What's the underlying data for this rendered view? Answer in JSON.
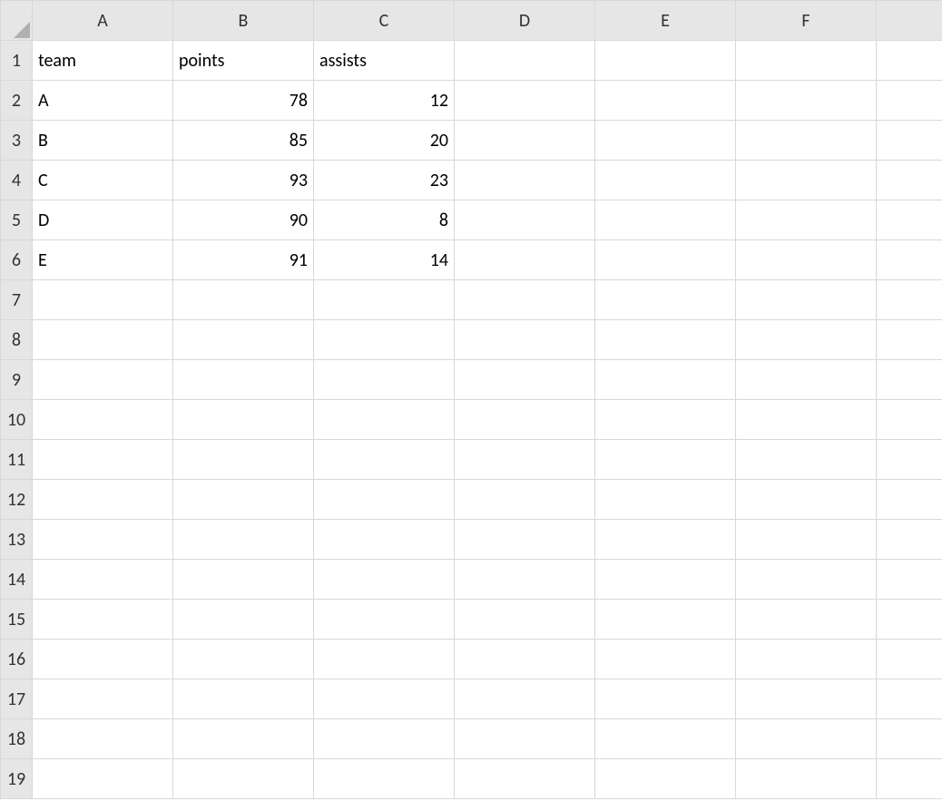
{
  "columns": [
    "A",
    "B",
    "C",
    "D",
    "E",
    "F",
    ""
  ],
  "rows": [
    "1",
    "2",
    "3",
    "4",
    "5",
    "6",
    "7",
    "8",
    "9",
    "10",
    "11",
    "12",
    "13",
    "14",
    "15",
    "16",
    "17",
    "18",
    "19"
  ],
  "cells": {
    "A1": "team",
    "B1": "points",
    "C1": "assists",
    "A2": "A",
    "B2": "78",
    "C2": "12",
    "A3": "B",
    "B3": "85",
    "C3": "20",
    "A4": "C",
    "B4": "93",
    "C4": "23",
    "A5": "D",
    "B5": "90",
    "C5": "8",
    "A6": "E",
    "B6": "91",
    "C6": "14"
  },
  "chart_data": {
    "type": "table",
    "title": "",
    "columns": [
      "team",
      "points",
      "assists"
    ],
    "rows": [
      {
        "team": "A",
        "points": 78,
        "assists": 12
      },
      {
        "team": "B",
        "points": 85,
        "assists": 20
      },
      {
        "team": "C",
        "points": 93,
        "assists": 23
      },
      {
        "team": "D",
        "points": 90,
        "assists": 8
      },
      {
        "team": "E",
        "points": 91,
        "assists": 14
      }
    ]
  }
}
